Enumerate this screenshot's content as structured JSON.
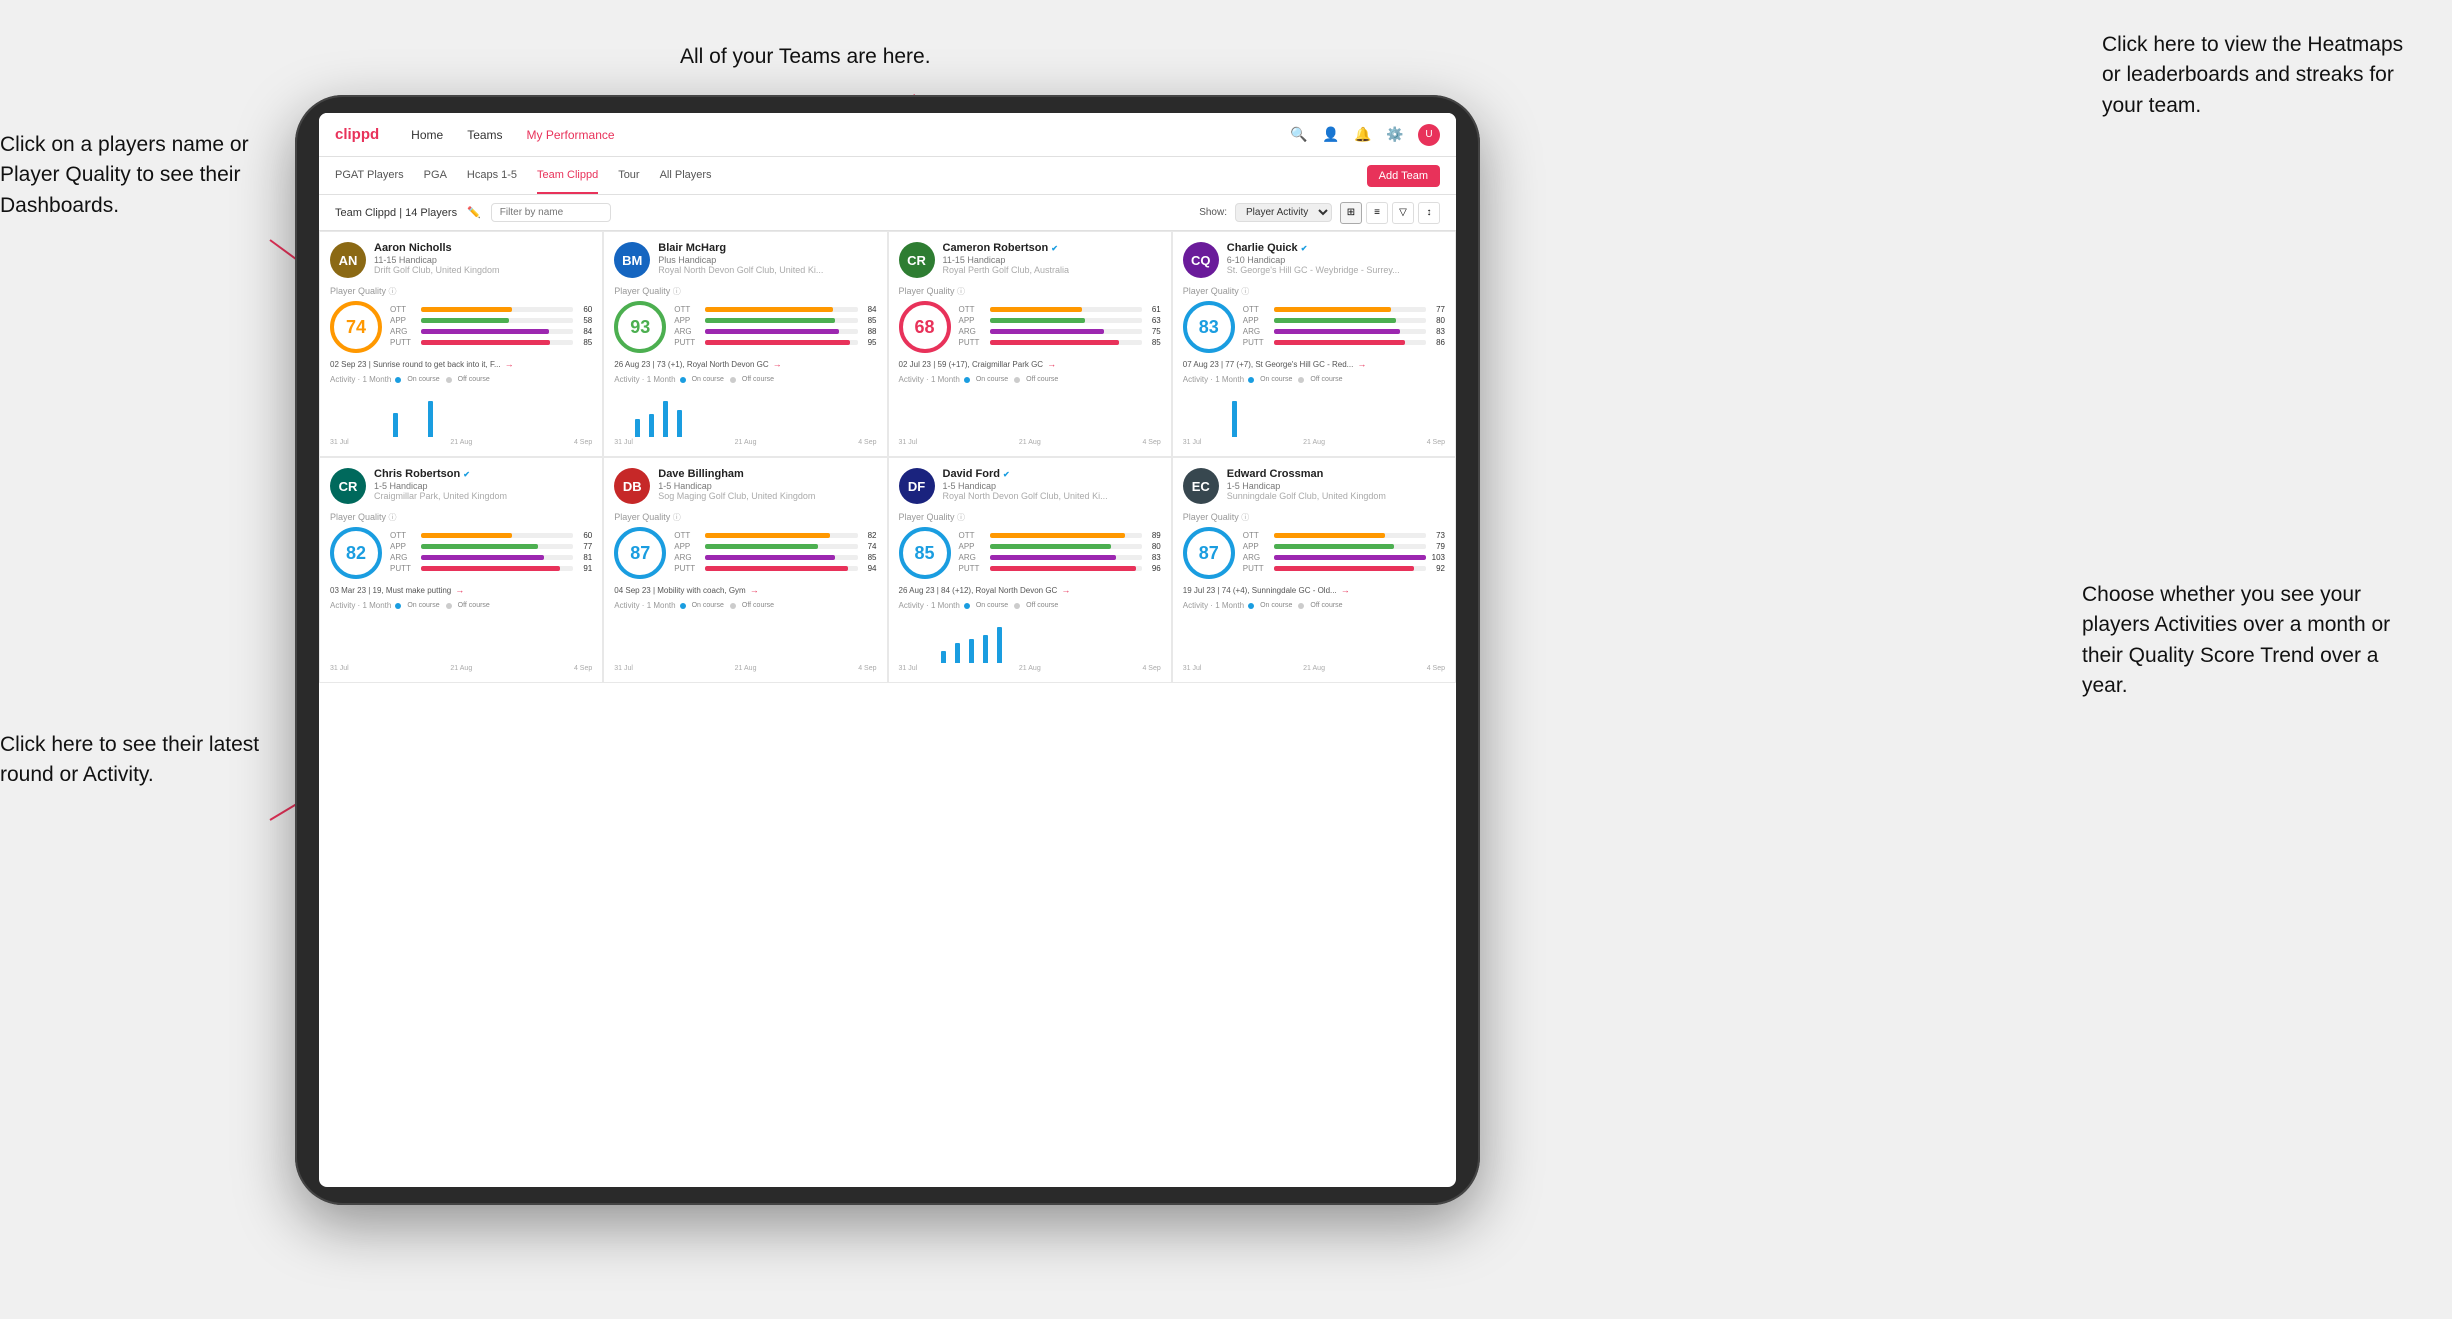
{
  "annotations": {
    "teams_header": "All of your Teams are here.",
    "heatmaps_header": "Click here to view the\nHeatmaps or leaderboards\nand streaks for your team.",
    "players_name": "Click on a players name\nor Player Quality to see\ntheir Dashboards.",
    "latest_round": "Click here to see their latest\nround or Activity.",
    "activities": "Choose whether you see\nyour players Activities over\na month or their Quality\nScore Trend over a year."
  },
  "nav": {
    "logo": "clippd",
    "items": [
      "Home",
      "Teams",
      "My Performance"
    ],
    "icons": [
      "search",
      "person",
      "bell",
      "settings",
      "avatar"
    ]
  },
  "tabs": {
    "items": [
      "PGAT Players",
      "PGA",
      "Hcaps 1-5",
      "Team Clippd",
      "Tour",
      "All Players"
    ],
    "active": "Team Clippd",
    "add_button": "Add Team"
  },
  "filter": {
    "team_label": "Team Clippd | 14 Players",
    "search_placeholder": "Filter by name",
    "show_label": "Show:",
    "show_options": [
      "Player Activity"
    ],
    "show_selected": "Player Activity"
  },
  "players": [
    {
      "name": "Aaron Nicholls",
      "handicap": "11-15 Handicap",
      "club": "Drift Golf Club, United Kingdom",
      "verified": false,
      "quality": 74,
      "quality_color": "blue",
      "ott": 60,
      "app": 58,
      "arg": 84,
      "putt": 85,
      "latest": "02 Sep 23 | Sunrise round to get back into it, F...",
      "activity_bars": [
        0,
        0,
        0,
        0,
        0,
        0,
        0,
        0,
        0,
        2,
        0,
        0,
        0,
        0,
        3,
        0
      ],
      "dates": [
        "31 Jul",
        "21 Aug",
        "4 Sep"
      ],
      "initials": "AN",
      "av_class": "av-brown"
    },
    {
      "name": "Blair McHarg",
      "handicap": "Plus Handicap",
      "club": "Royal North Devon Golf Club, United Ki...",
      "verified": false,
      "quality": 93,
      "quality_color": "green",
      "ott": 84,
      "app": 85,
      "arg": 88,
      "putt": 95,
      "latest": "26 Aug 23 | 73 (+1), Royal North Devon GC",
      "activity_bars": [
        0,
        0,
        0,
        4,
        0,
        5,
        0,
        8,
        0,
        6,
        0,
        0,
        0,
        0,
        0,
        0
      ],
      "dates": [
        "31 Jul",
        "21 Aug",
        "4 Sep"
      ],
      "initials": "BM",
      "av_class": "av-blue"
    },
    {
      "name": "Cameron Robertson",
      "handicap": "11-15 Handicap",
      "club": "Royal Perth Golf Club, Australia",
      "verified": true,
      "quality": 68,
      "quality_color": "orange",
      "ott": 61,
      "app": 63,
      "arg": 75,
      "putt": 85,
      "latest": "02 Jul 23 | 59 (+17), Craigmillar Park GC",
      "activity_bars": [
        0,
        0,
        0,
        0,
        0,
        0,
        0,
        0,
        0,
        0,
        0,
        0,
        0,
        0,
        0,
        0
      ],
      "dates": [
        "31 Jul",
        "21 Aug",
        "4 Sep"
      ],
      "initials": "CR",
      "av_class": "av-green"
    },
    {
      "name": "Charlie Quick",
      "handicap": "6-10 Handicap",
      "club": "St. George's Hill GC - Weybridge - Surrey...",
      "verified": true,
      "quality": 83,
      "quality_color": "blue",
      "ott": 77,
      "app": 80,
      "arg": 83,
      "putt": 86,
      "latest": "07 Aug 23 | 77 (+7), St George's Hill GC - Red...",
      "activity_bars": [
        0,
        0,
        0,
        0,
        0,
        0,
        0,
        3,
        0,
        0,
        0,
        0,
        0,
        0,
        0,
        0
      ],
      "dates": [
        "31 Jul",
        "21 Aug",
        "4 Sep"
      ],
      "initials": "CQ",
      "av_class": "av-purple"
    },
    {
      "name": "Chris Robertson",
      "handicap": "1-5 Handicap",
      "club": "Craigmillar Park, United Kingdom",
      "verified": true,
      "quality": 82,
      "quality_color": "blue",
      "ott": 60,
      "app": 77,
      "arg": 81,
      "putt": 91,
      "latest": "03 Mar 23 | 19, Must make putting",
      "activity_bars": [
        0,
        0,
        0,
        0,
        0,
        0,
        0,
        0,
        0,
        0,
        0,
        0,
        0,
        0,
        0,
        0
      ],
      "dates": [
        "31 Jul",
        "21 Aug",
        "4 Sep"
      ],
      "initials": "CR",
      "av_class": "av-teal"
    },
    {
      "name": "Dave Billingham",
      "handicap": "1-5 Handicap",
      "club": "Sog Maging Golf Club, United Kingdom",
      "verified": false,
      "quality": 87,
      "quality_color": "blue",
      "ott": 82,
      "app": 74,
      "arg": 85,
      "putt": 94,
      "latest": "04 Sep 23 | Mobility with coach, Gym",
      "activity_bars": [
        0,
        0,
        0,
        0,
        0,
        0,
        0,
        0,
        0,
        0,
        0,
        0,
        0,
        0,
        0,
        0
      ],
      "dates": [
        "31 Jul",
        "21 Aug",
        "4 Sep"
      ],
      "initials": "DB",
      "av_class": "av-red"
    },
    {
      "name": "David Ford",
      "handicap": "1-5 Handicap",
      "club": "Royal North Devon Golf Club, United Ki...",
      "verified": true,
      "quality": 85,
      "quality_color": "blue",
      "ott": 89,
      "app": 80,
      "arg": 83,
      "putt": 96,
      "latest": "26 Aug 23 | 84 (+12), Royal North Devon GC",
      "activity_bars": [
        0,
        0,
        0,
        0,
        0,
        0,
        3,
        0,
        5,
        0,
        6,
        0,
        7,
        0,
        9,
        0
      ],
      "dates": [
        "31 Jul",
        "21 Aug",
        "4 Sep"
      ],
      "initials": "DF",
      "av_class": "av-navy"
    },
    {
      "name": "Edward Crossman",
      "handicap": "1-5 Handicap",
      "club": "Sunningdale Golf Club, United Kingdom",
      "verified": false,
      "quality": 87,
      "quality_color": "blue",
      "ott": 73,
      "app": 79,
      "arg": 103,
      "putt": 92,
      "latest": "19 Jul 23 | 74 (+4), Sunningdale GC - Old...",
      "activity_bars": [
        0,
        0,
        0,
        0,
        0,
        0,
        0,
        0,
        0,
        0,
        0,
        0,
        0,
        0,
        0,
        0
      ],
      "dates": [
        "31 Jul",
        "21 Aug",
        "4 Sep"
      ],
      "initials": "EC",
      "av_class": "av-dark"
    }
  ]
}
